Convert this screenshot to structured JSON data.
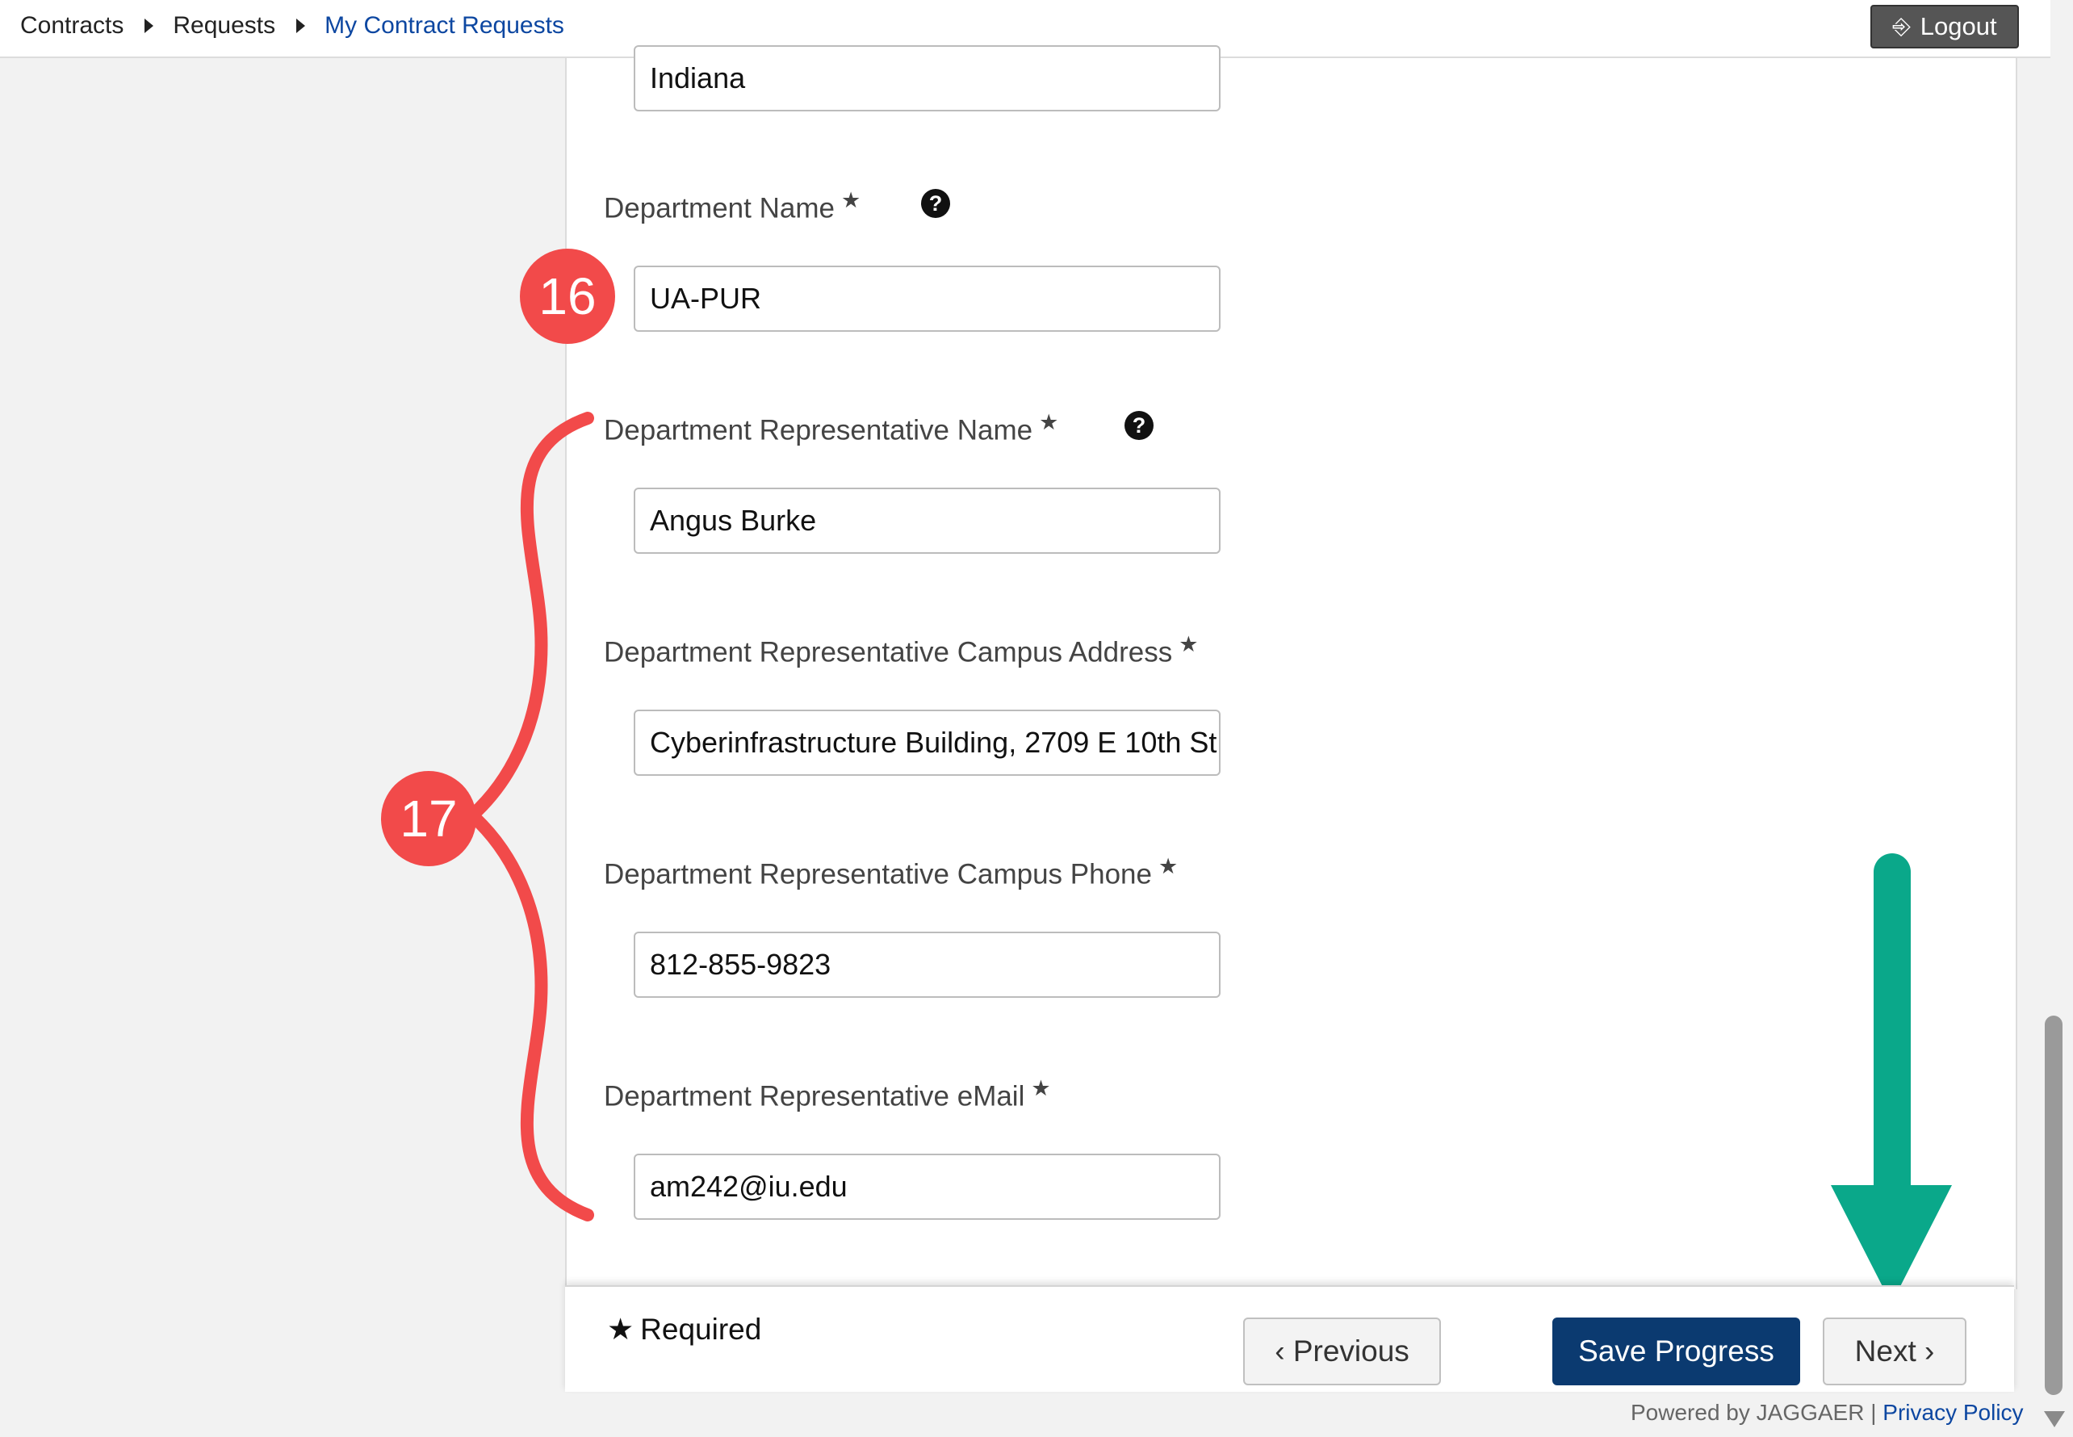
{
  "breadcrumb": {
    "items": [
      "Contracts",
      "Requests",
      "My Contract Requests"
    ]
  },
  "header": {
    "logout_label": "Logout",
    "logout_icon": "logout-icon"
  },
  "form": {
    "state_value": "Indiana",
    "department_name": {
      "label": "Department Name",
      "value": "UA-PUR",
      "required_mark": "★",
      "help_icon": "question-circle-icon"
    },
    "rep_name": {
      "label": "Department Representative Name",
      "value": "Angus Burke",
      "required_mark": "★",
      "help_icon": "question-circle-icon"
    },
    "rep_address": {
      "label": "Department Representative Campus Address",
      "value": "Cyberinfrastructure Building, 2709 E 10th St",
      "required_mark": "★"
    },
    "rep_phone": {
      "label": "Department Representative Campus Phone",
      "value": "812-855-9823",
      "required_mark": "★"
    },
    "rep_email": {
      "label": "Department Representative eMail",
      "value": "am242@iu.edu",
      "required_mark": "★"
    }
  },
  "annotations": {
    "badge_16": "16",
    "badge_17": "17",
    "badge_color": "#f24a4a",
    "arrow_color": "#0aa88a"
  },
  "footer": {
    "required_mark": "★",
    "required_label": "Required",
    "previous_label": "‹ Previous",
    "save_label": "Save Progress",
    "next_label": "Next ›"
  },
  "powered": {
    "text": "Powered by JAGGAER",
    "separator": "|",
    "privacy_label": "Privacy Policy"
  }
}
